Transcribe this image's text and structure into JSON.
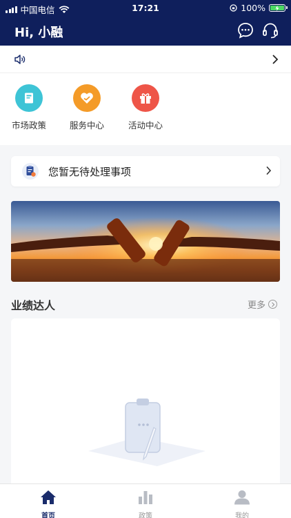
{
  "status_bar": {
    "carrier": "中国电信",
    "time": "17:21",
    "battery_percent": "100%"
  },
  "header": {
    "greeting": "Hi, 小融",
    "icons": [
      "message-icon",
      "headset-icon"
    ],
    "bg_color": "#0f1f5c"
  },
  "notice": {
    "icons": [
      "speaker-icon",
      "chevron-right-icon"
    ]
  },
  "quick_actions": [
    {
      "label": "市场政策",
      "icon": "book-icon",
      "color": "#3ec4d6"
    },
    {
      "label": "服务中心",
      "icon": "heart-icon",
      "color": "#f49b28"
    },
    {
      "label": "活动中心",
      "icon": "gift-icon",
      "color": "#ee5548"
    }
  ],
  "todo": {
    "text": "您暂无待处理事项",
    "icon": "clipboard-icon"
  },
  "banner": {
    "image": "sunset-cheers-photo"
  },
  "performance": {
    "title": "业绩达人",
    "more_label": "更多"
  },
  "tabbar": {
    "tabs": [
      {
        "label": "首页",
        "icon": "home-icon",
        "active": true
      },
      {
        "label": "政策",
        "icon": "bar-chart-icon",
        "active": false
      },
      {
        "label": "我的",
        "icon": "user-icon",
        "active": false
      }
    ],
    "active_color": "#1a2c6b"
  }
}
